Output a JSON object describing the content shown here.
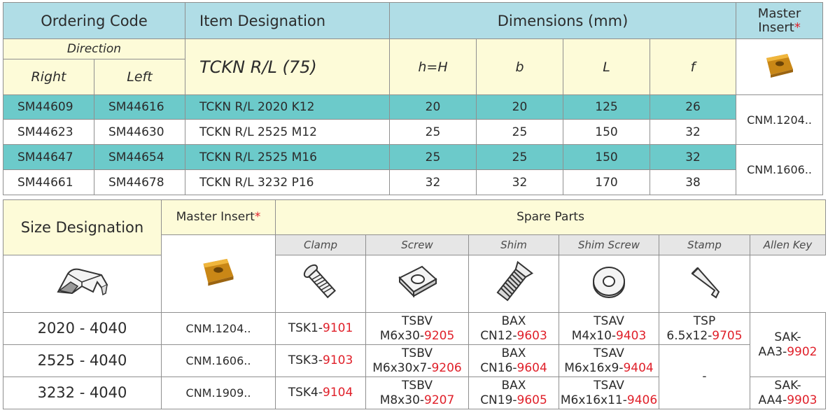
{
  "top_table": {
    "headers": {
      "ordering_code": "Ordering Code",
      "item_designation": "Item Designation",
      "dimensions": "Dimensions (mm)",
      "master_insert": "Master",
      "master_insert_line2": "Insert",
      "asterisk": "*"
    },
    "subheaders": {
      "direction": "Direction",
      "right": "Right",
      "left": "Left",
      "item_family": "TCKN R/L (75)",
      "h": "h=H",
      "b": "b",
      "L": "L",
      "f": "f"
    },
    "rows": [
      {
        "right": "SM44609",
        "left": "SM44616",
        "item": "TCKN R/L 2020 K12",
        "h": "20",
        "b": "20",
        "L": "125",
        "f": "26"
      },
      {
        "right": "SM44623",
        "left": "SM44630",
        "item": "TCKN R/L 2525 M12",
        "h": "25",
        "b": "25",
        "L": "150",
        "f": "32"
      },
      {
        "right": "SM44647",
        "left": "SM44654",
        "item": "TCKN R/L 2525 M16",
        "h": "25",
        "b": "25",
        "L": "150",
        "f": "32"
      },
      {
        "right": "SM44661",
        "left": "SM44678",
        "item": "TCKN R/L 3232 P16",
        "h": "32",
        "b": "32",
        "L": "170",
        "f": "38"
      }
    ],
    "inserts": [
      "CNM.1204..",
      "CNM.1606.."
    ]
  },
  "bottom_table": {
    "headers": {
      "size_designation": "Size Designation",
      "master_insert": "Master Insert",
      "asterisk": "*",
      "spare_parts": "Spare Parts"
    },
    "parts": {
      "clamp": "Clamp",
      "screw": "Screw",
      "shim": "Shim",
      "shim_screw": "Shim Screw",
      "stamp": "Stamp",
      "allen_key": "Allen Key"
    },
    "rows": [
      {
        "size": "2020 - 4040",
        "insert": "CNM.1204..",
        "clamp": {
          "a": "TSK1-",
          "b": "9101"
        },
        "screw": {
          "l1": "TSBV",
          "a": "M6x30-",
          "b": "9205"
        },
        "shim": {
          "l1": "BAX",
          "a": "CN12-",
          "b": "9603"
        },
        "shim_screw": {
          "l1": "TSAV",
          "a": "M4x10-",
          "b": "9403"
        },
        "stamp": {
          "l1": "TSP",
          "a": "6.5x12-",
          "b": "9705"
        }
      },
      {
        "size": "2525 - 4040",
        "insert": "CNM.1606..",
        "clamp": {
          "a": "TSK3-",
          "b": "9103"
        },
        "screw": {
          "l1": "TSBV",
          "a": "M6x30x7-",
          "b": "9206"
        },
        "shim": {
          "l1": "BAX",
          "a": "CN16-",
          "b": "9604"
        },
        "shim_screw": {
          "l1": "TSAV",
          "a": "M6x16x9-",
          "b": "9404"
        }
      },
      {
        "size": "3232 - 4040",
        "insert": "CNM.1909..",
        "clamp": {
          "a": "TSK4-",
          "b": "9104"
        },
        "screw": {
          "l1": "TSBV",
          "a": "M8x30-",
          "b": "9207"
        },
        "shim": {
          "l1": "BAX",
          "a": "CN19-",
          "b": "9605"
        },
        "shim_screw": {
          "l1": "TSAV",
          "a": "M6x16x11-",
          "b": "9406"
        }
      }
    ],
    "stamp_empty": "-",
    "allen_keys": [
      {
        "l1": "SAK-",
        "a": "AA3-",
        "b": "9902"
      },
      {
        "l1": "SAK-",
        "a": "AA4-",
        "b": "9903"
      }
    ]
  },
  "colors": {
    "header_blue": "#b0dde6",
    "header_yellow": "#fdfbd8",
    "row_teal": "#6ccaca",
    "accent_red": "#e0202a",
    "insert_gold": "#e3a12a"
  },
  "icons": [
    "insert-icon",
    "clamp-icon",
    "screw-icon",
    "shim-icon",
    "shim-screw-icon",
    "stamp-icon",
    "allen-key-icon"
  ]
}
